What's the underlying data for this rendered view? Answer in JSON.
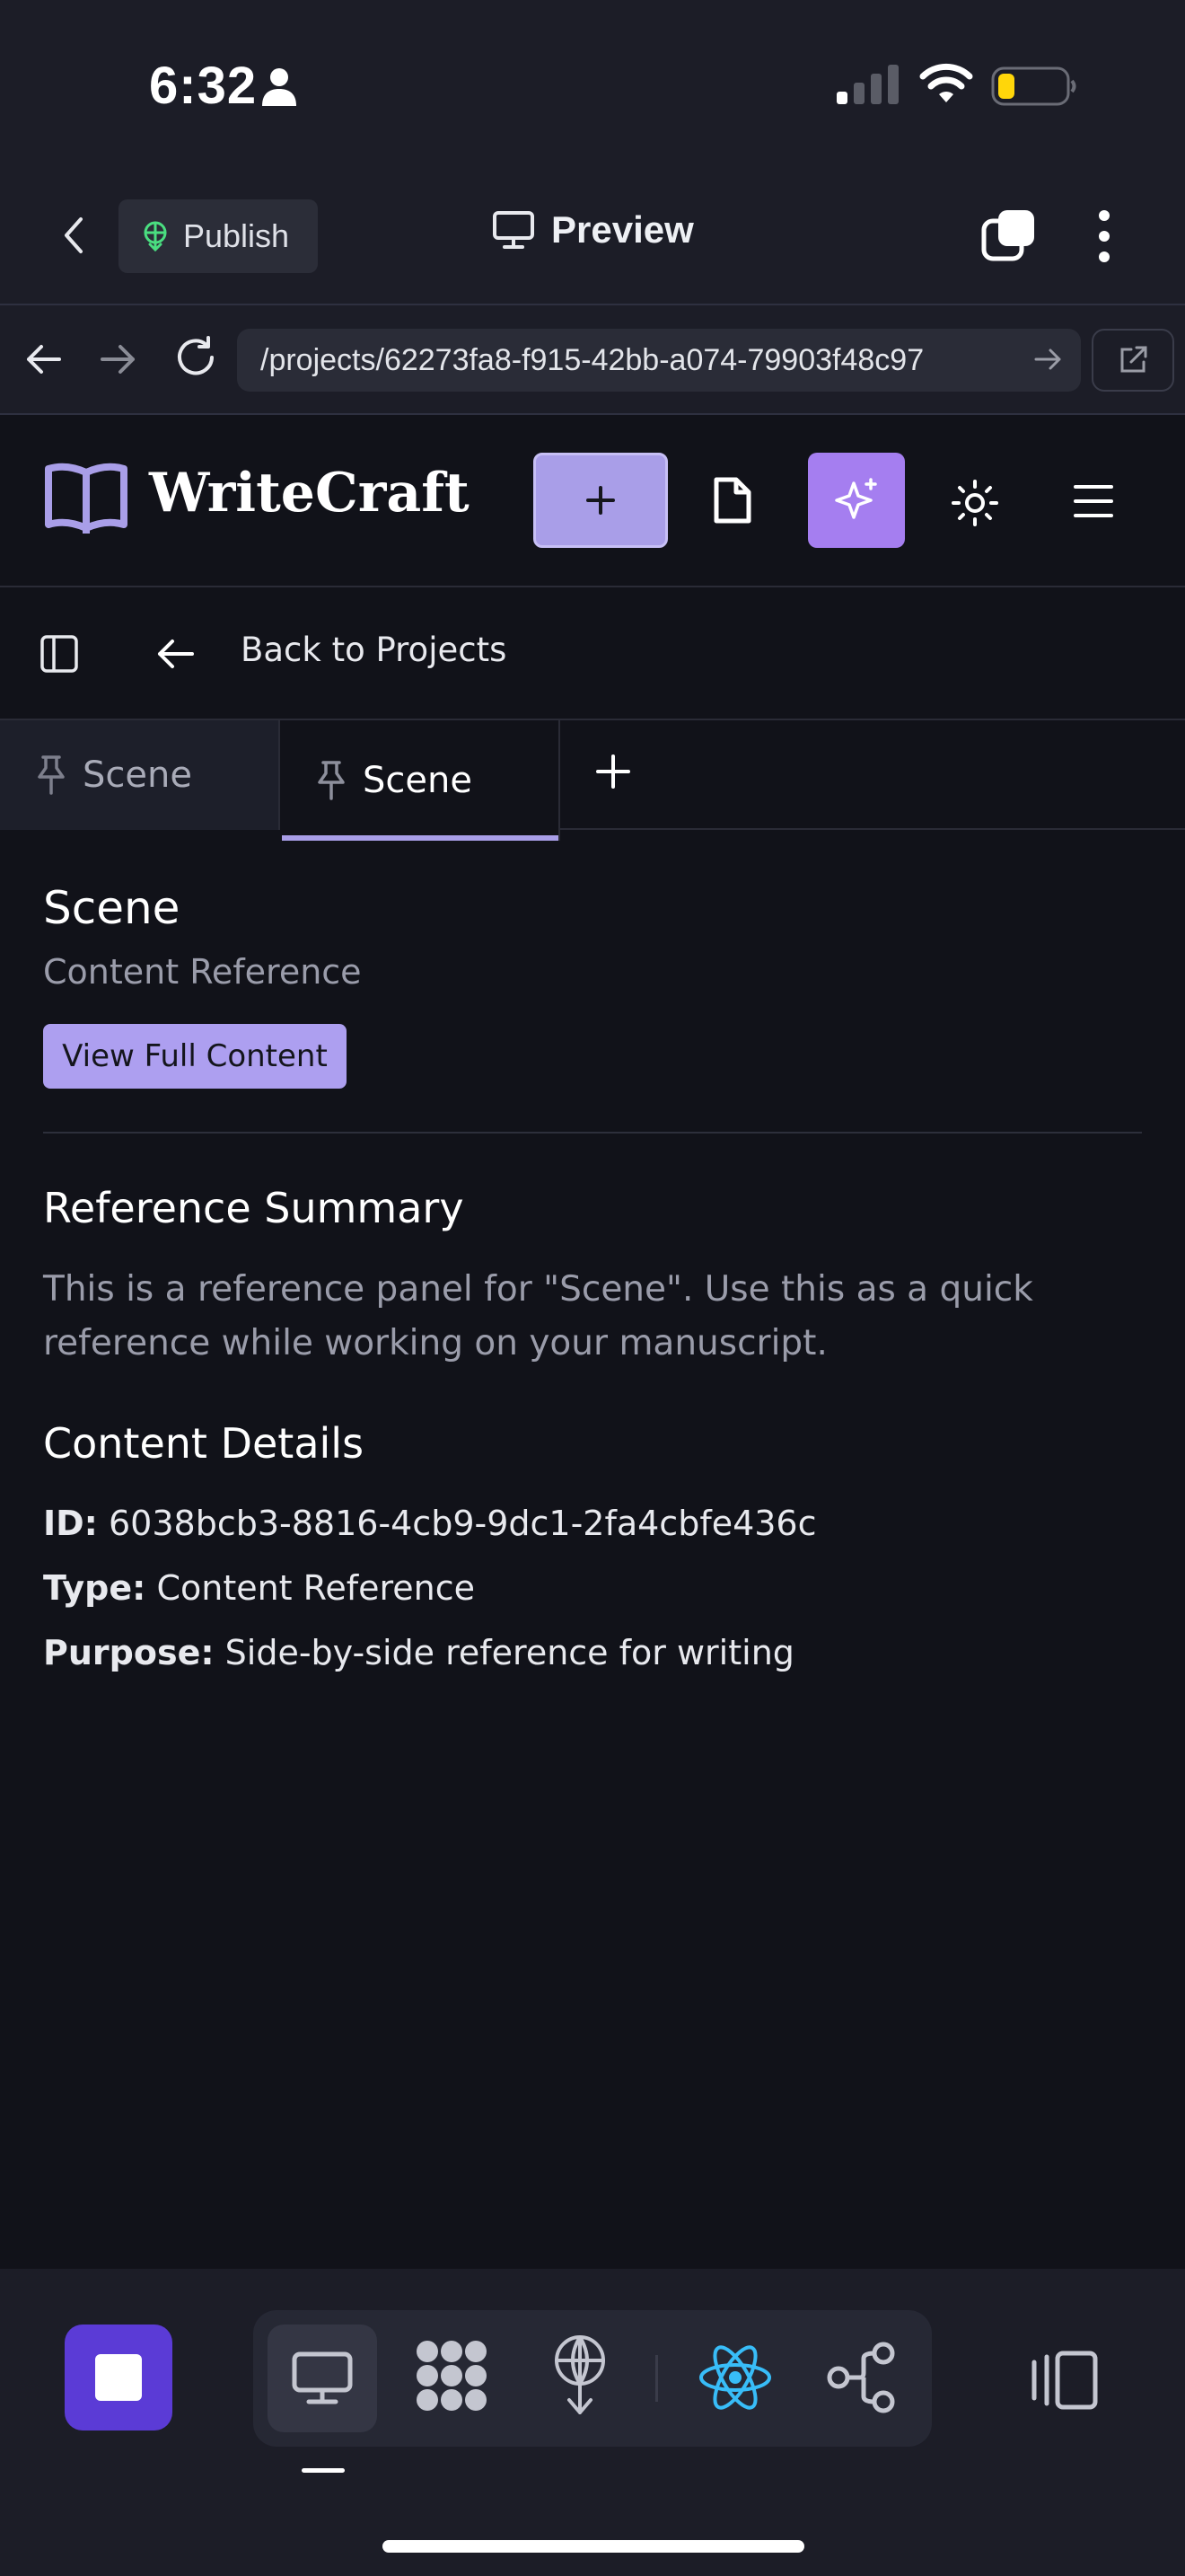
{
  "status_bar": {
    "time": "6:32",
    "battery_color": "#ffd60a"
  },
  "browser": {
    "publish_label": "Publish",
    "preview_label": "Preview",
    "url": "/projects/62273fa8-f915-42bb-a074-79903f48c97"
  },
  "app": {
    "name": "WriteCraft",
    "accent_color": "#a99ee8",
    "back_label": "Back to Projects",
    "tabs": [
      {
        "label": "Scene",
        "active": false
      },
      {
        "label": "Scene",
        "active": true
      }
    ]
  },
  "panel": {
    "title": "Scene",
    "subtitle": "Content Reference",
    "view_button": "View Full Content",
    "summary_heading": "Reference Summary",
    "summary_text": "This is a reference panel for \"Scene\". Use this as a quick reference while working on your manuscript.",
    "details_heading": "Content Details",
    "details": {
      "id_label": "ID:",
      "id_value": "6038bcb3-8816-4cb9-9dc1-2fa4cbfe436c",
      "type_label": "Type:",
      "type_value": "Content Reference",
      "purpose_label": "Purpose:",
      "purpose_value": "Side-by-side reference for writing"
    }
  },
  "dock": {
    "icons": [
      "stop-icon",
      "monitor-icon",
      "ai-agent-icon",
      "deploy-icon",
      "react-icon",
      "git-icon",
      "panels-icon"
    ]
  }
}
